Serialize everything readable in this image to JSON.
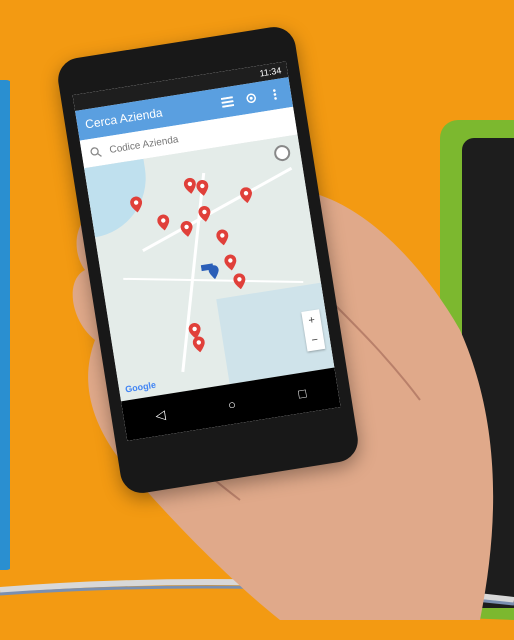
{
  "colors": {
    "background": "#f39a12",
    "appbar": "#5a9fe0",
    "pin": "#e0403a",
    "green_card": "#7cb82f",
    "left_strip": "#2a8fd0"
  },
  "status_bar": {
    "time": "11:34"
  },
  "app_bar": {
    "title": "Cerca Azienda",
    "icons": [
      "list-icon",
      "locate-icon",
      "more-vert-icon"
    ]
  },
  "search": {
    "placeholder": "Codice Azienda"
  },
  "map": {
    "zoom_in": "+",
    "zoom_out": "−",
    "provider_logo": "Google"
  },
  "nav_bar": {
    "back": "◁",
    "home": "○",
    "recents": "□"
  }
}
